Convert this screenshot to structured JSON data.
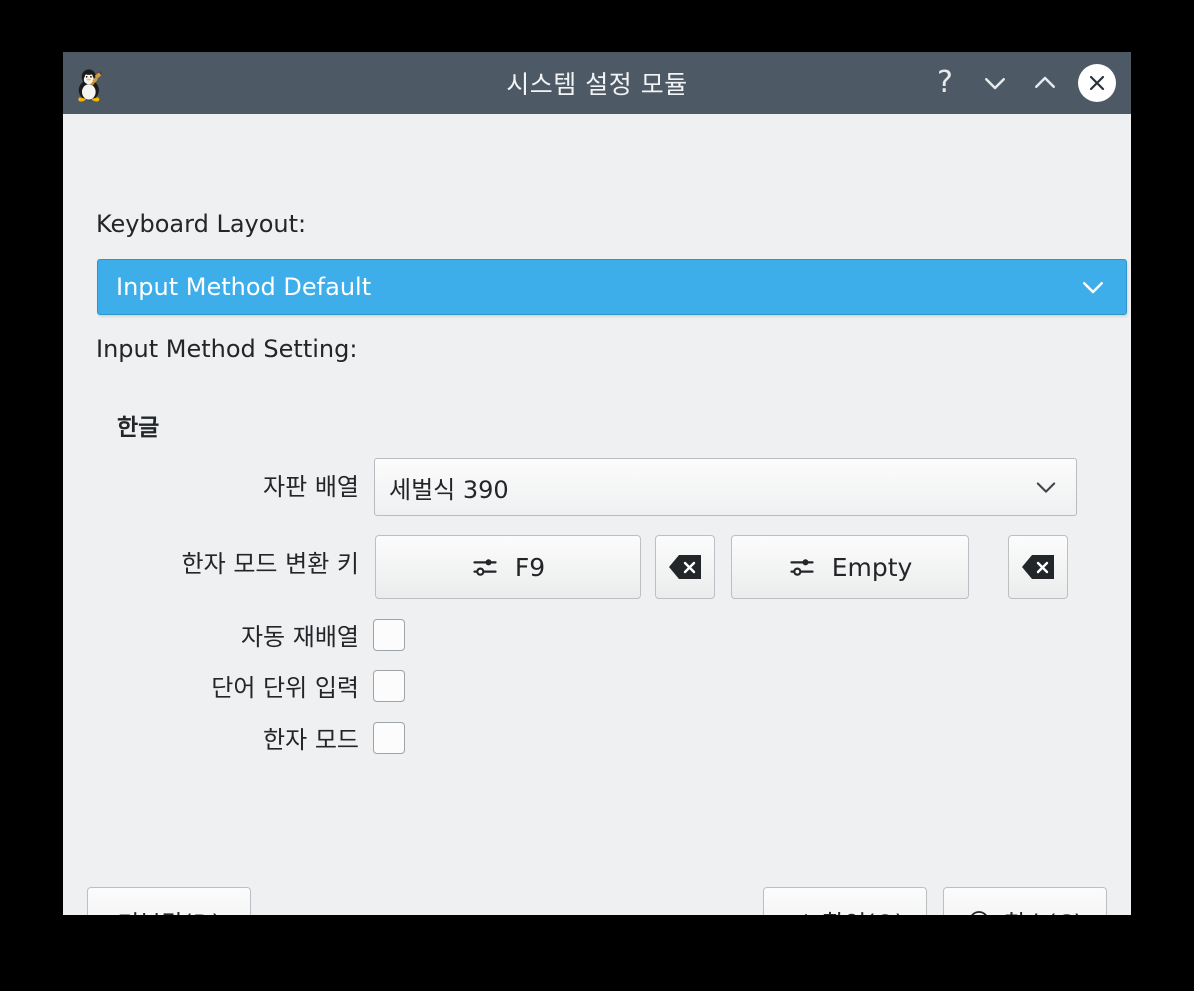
{
  "window": {
    "title": "시스템 설정 모듈",
    "app_icon": "tux-penguin-icon",
    "controls": {
      "help": "?",
      "shade": "chevron-down-icon",
      "unshade": "chevron-up-icon",
      "close": "close-icon"
    },
    "colors": {
      "titlebar": "#4d5a65",
      "body": "#eff0f1",
      "highlight": "#3daee9",
      "text": "#232629"
    }
  },
  "form": {
    "keyboard_layout_label": "Keyboard Layout:",
    "keyboard_layout_value": "Input Method Default",
    "input_method_setting_label": "Input Method Setting:",
    "group_heading": "한글",
    "layout_row": {
      "label": "자판 배열",
      "value": "세벌식 390"
    },
    "hotkey_row": {
      "label": "한자 모드 변환 키",
      "key1": "F9",
      "key2": "Empty",
      "clear_icon": "backspace-icon",
      "configure_icon": "sliders-icon"
    },
    "checkboxes": [
      {
        "label": "자동 재배열",
        "checked": false
      },
      {
        "label": "단어 단위 입력",
        "checked": false
      },
      {
        "label": "한자 모드",
        "checked": false
      }
    ]
  },
  "buttons": {
    "defaults": "기본값(D)",
    "ok": "확인(O)",
    "cancel": "취소(C)",
    "ok_icon": "check-icon",
    "cancel_icon": "prohibited-icon"
  }
}
